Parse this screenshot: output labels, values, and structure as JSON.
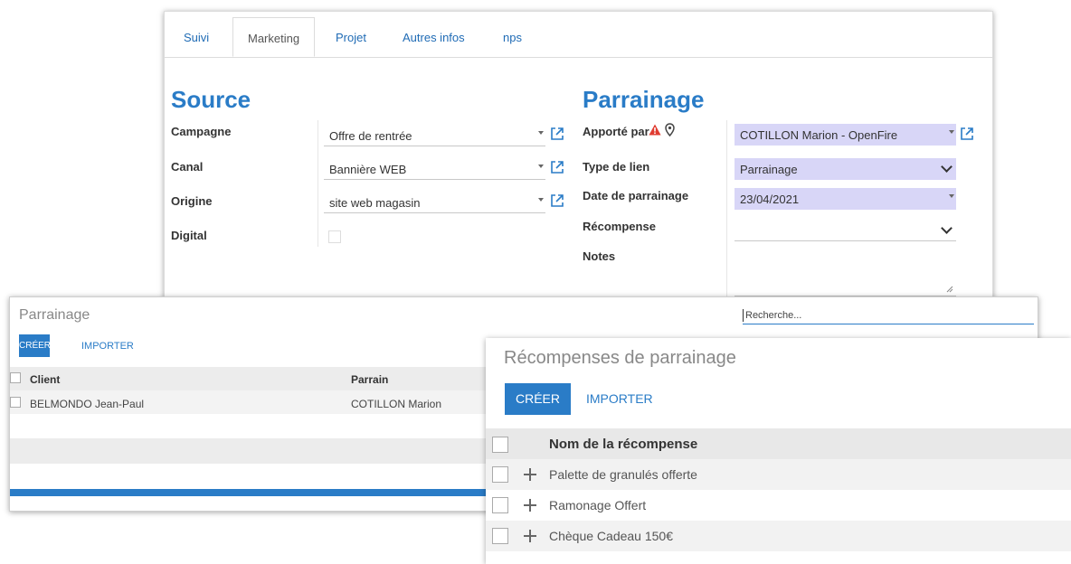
{
  "form": {
    "tabs": [
      "Suivi",
      "Marketing",
      "Projet",
      "Autres infos",
      "nps"
    ],
    "source": {
      "title": "Source",
      "campagne_label": "Campagne",
      "campagne_value": "Offre de rentrée",
      "canal_label": "Canal",
      "canal_value": "Bannière WEB",
      "origine_label": "Origine",
      "origine_value": "site web magasin",
      "digital_label": "Digital"
    },
    "parrainage": {
      "title": "Parrainage",
      "apporte_label": "Apporté par",
      "apporte_value": "COTILLON Marion - OpenFire",
      "type_label": "Type de lien",
      "type_value": "Parrainage",
      "date_label": "Date de parrainage",
      "date_value": "23/04/2021",
      "recompense_label": "Récompense",
      "recompense_value": "",
      "notes_label": "Notes"
    },
    "colors": {
      "accent": "#2a7cc7",
      "highlight": "#d8d6f7",
      "warning": "#e03c31"
    },
    "icons": {
      "warning": "warning-icon",
      "location": "map-pin-icon",
      "external": "external-link-icon"
    }
  },
  "list": {
    "title": "Parrainage",
    "search_placeholder": "Recherche...",
    "create_label": "CRÉER",
    "import_label": "IMPORTER",
    "col_client": "Client",
    "col_parrain": "Parrain",
    "rows": [
      {
        "client": "BELMONDO Jean-Paul",
        "parrain": "COTILLON Marion"
      }
    ]
  },
  "rewards": {
    "title": "Récompenses de parrainage",
    "create_label": "CRÉER",
    "import_label": "IMPORTER",
    "col_name": "Nom de la récompense",
    "items": [
      "Palette de granulés offerte",
      "Ramonage Offert",
      "Chèque Cadeau 150€"
    ]
  }
}
